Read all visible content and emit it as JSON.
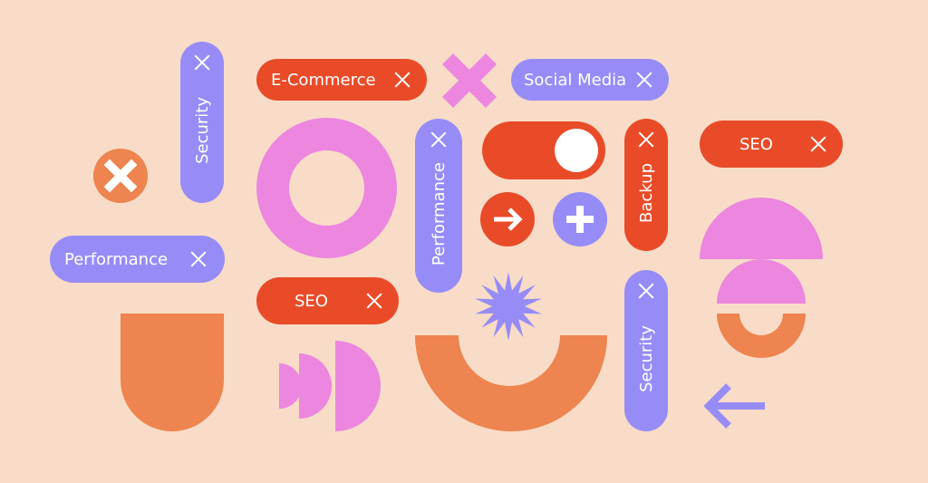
{
  "colors": {
    "background": "#F8DCC7",
    "red": "#E94B29",
    "purple": "#978CF7",
    "orange": "#EE844F",
    "pink": "#EC86DF",
    "white": "#FFFFFF"
  },
  "tags": {
    "security_top": "Security",
    "performance_left": "Performance",
    "ecommerce": "E-Commerce",
    "social_media": "Social Media",
    "performance_vertical": "Performance",
    "backup": "Backup",
    "seo_right": "SEO",
    "seo_bottom": "SEO",
    "security_bottom": "Security"
  },
  "toggle": {
    "state": "on"
  },
  "icons": {
    "remove_badge": "close-circle-icon",
    "arrow_right": "arrow-right-icon",
    "plus": "plus-icon",
    "arrow_left": "arrow-left-icon",
    "big_x": "cross-icon",
    "starburst": "star-icon"
  }
}
